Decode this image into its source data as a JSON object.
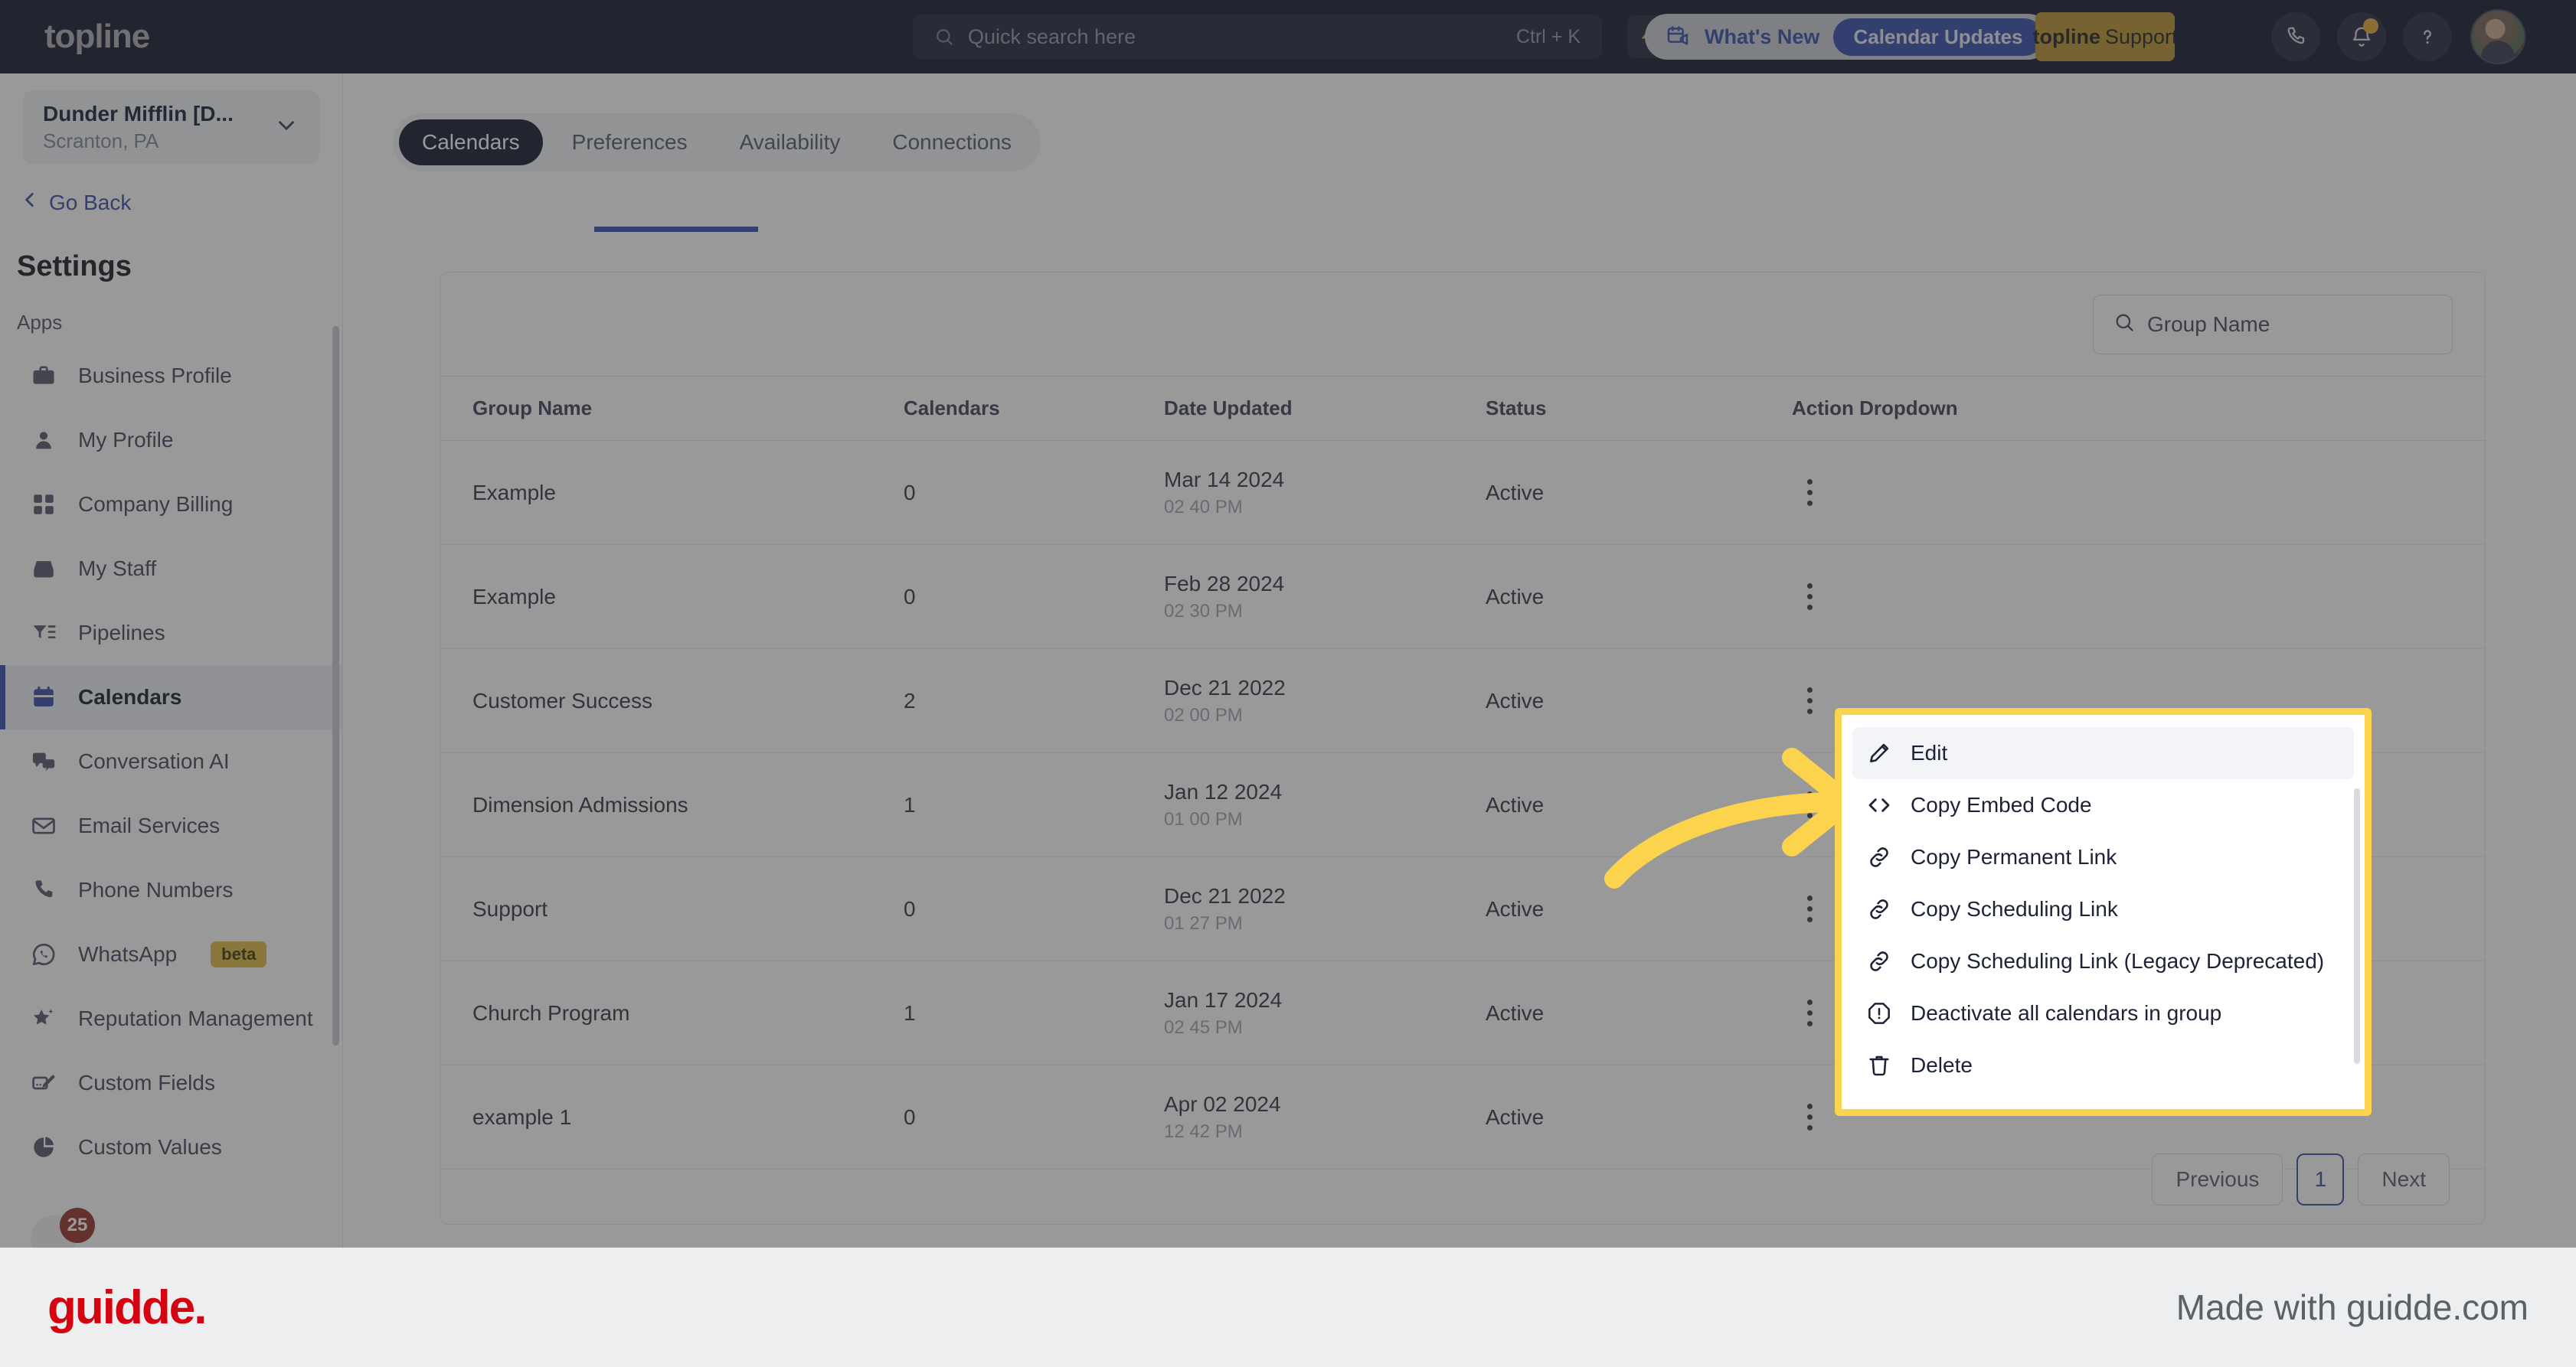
{
  "topbar": {
    "brand": "topline",
    "search": {
      "placeholder": "Quick search here",
      "value": "",
      "shortcut": "Ctrl + K",
      "icon": "search-icon"
    },
    "bolt_icon": "lightning-bolt-icon",
    "whats_new": {
      "label": "What's New",
      "badge": "Calendar Updates",
      "icon": "calendar-announcement-icon"
    },
    "support_button": {
      "brand": "topline",
      "label": "Support"
    },
    "icons": {
      "phone": "phone-icon",
      "bell": "bell-icon",
      "help": "question-mark-icon"
    },
    "avatar": "user-avatar"
  },
  "sidebar": {
    "location": {
      "name": "Dunder Mifflin [D...",
      "sub": "Scranton, PA",
      "chevron": "chevron-down-icon"
    },
    "go_back": {
      "label": "Go Back",
      "icon": "chevron-left-icon"
    },
    "title": "Settings",
    "section_label": "Apps",
    "items": [
      {
        "label": "Business Profile",
        "icon": "briefcase-icon",
        "active": false
      },
      {
        "label": "My Profile",
        "icon": "person-icon",
        "active": false
      },
      {
        "label": "Company Billing",
        "icon": "calculator-icon",
        "active": false
      },
      {
        "label": "My Staff",
        "icon": "inbox-icon",
        "active": false
      },
      {
        "label": "Pipelines",
        "icon": "filter-list-icon",
        "active": false
      },
      {
        "label": "Calendars",
        "icon": "calendar-icon",
        "active": true
      },
      {
        "label": "Conversation AI",
        "icon": "chat-bubbles-icon",
        "active": false
      },
      {
        "label": "Email Services",
        "icon": "envelope-icon",
        "active": false
      },
      {
        "label": "Phone Numbers",
        "icon": "phone-icon",
        "active": false
      },
      {
        "label": "WhatsApp",
        "icon": "whatsapp-icon",
        "active": false,
        "badge": "beta"
      },
      {
        "label": "Reputation Management",
        "icon": "star-sparkle-icon",
        "active": false
      },
      {
        "label": "Custom Fields",
        "icon": "edit-field-icon",
        "active": false
      },
      {
        "label": "Custom Values",
        "icon": "pie-chart-icon",
        "active": false
      }
    ],
    "partial_item_badge": "25"
  },
  "main": {
    "tabs": [
      {
        "label": "Calendars",
        "active": true
      },
      {
        "label": "Preferences",
        "active": false
      },
      {
        "label": "Availability",
        "active": false
      },
      {
        "label": "Connections",
        "active": false
      }
    ],
    "group_search": {
      "placeholder": "Group Name",
      "value": "",
      "icon": "search-icon"
    },
    "table": {
      "columns": [
        "Group Name",
        "Calendars",
        "Date Updated",
        "Status",
        "Action Dropdown"
      ],
      "rows": [
        {
          "name": "Example",
          "calendars": "0",
          "date": "Mar 14 2024",
          "time": "02 40 PM",
          "status": "Active",
          "action_icon": "kebab-menu-icon"
        },
        {
          "name": "Example",
          "calendars": "0",
          "date": "Feb 28 2024",
          "time": "02 30 PM",
          "status": "Active",
          "action_icon": "kebab-menu-icon"
        },
        {
          "name": "Customer Success",
          "calendars": "2",
          "date": "Dec 21 2022",
          "time": "02 00 PM",
          "status": "Active",
          "action_icon": "kebab-menu-icon"
        },
        {
          "name": "Dimension Admissions",
          "calendars": "1",
          "date": "Jan 12 2024",
          "time": "01 00 PM",
          "status": "Active",
          "action_icon": "kebab-menu-icon"
        },
        {
          "name": "Support",
          "calendars": "0",
          "date": "Dec 21 2022",
          "time": "01 27 PM",
          "status": "Active",
          "action_icon": "kebab-menu-icon"
        },
        {
          "name": "Church Program",
          "calendars": "1",
          "date": "Jan 17 2024",
          "time": "02 45 PM",
          "status": "Active",
          "action_icon": "kebab-menu-icon"
        },
        {
          "name": "example 1",
          "calendars": "0",
          "date": "Apr 02 2024",
          "time": "12 42 PM",
          "status": "Active",
          "action_icon": "kebab-menu-icon"
        }
      ]
    },
    "pagination": {
      "previous": "Previous",
      "current_page": "1",
      "next": "Next"
    }
  },
  "dropdown_menu": {
    "items": [
      {
        "label": "Edit",
        "icon": "pencil-icon",
        "highlighted": true
      },
      {
        "label": "Copy Embed Code",
        "icon": "code-brackets-icon",
        "highlighted": false
      },
      {
        "label": "Copy Permanent Link",
        "icon": "link-icon",
        "highlighted": false
      },
      {
        "label": "Copy Scheduling Link",
        "icon": "link-icon",
        "highlighted": false
      },
      {
        "label": "Copy Scheduling Link (Legacy Deprecated)",
        "icon": "link-icon",
        "highlighted": false
      },
      {
        "label": "Deactivate all calendars in group",
        "icon": "alert-octagon-icon",
        "highlighted": false
      },
      {
        "label": "Delete",
        "icon": "trash-icon",
        "highlighted": false
      }
    ]
  },
  "annotation": {
    "arrow_icon": "curved-arrow-right-icon",
    "highlight_color": "#FBD34D"
  },
  "footer": {
    "logo": "guidde.",
    "made_with": "Made with guidde.com"
  },
  "colors": {
    "topbar_bg": "#080E22",
    "accent_blue": "#2B45A8",
    "support_gold": "#B88C28",
    "highlight_yellow": "#FBD34D",
    "guidde_red": "#D40511"
  }
}
